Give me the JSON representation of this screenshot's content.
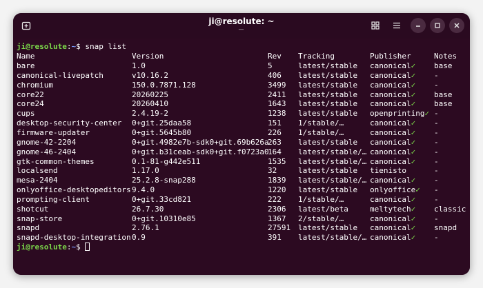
{
  "window": {
    "title": "ji@resolute: ~",
    "title_sub": "—"
  },
  "icons": {
    "new_tab": "new-tab-icon",
    "grid": "grid-icon",
    "menu": "hamburger-menu-icon",
    "minimize": "minimize-icon",
    "maximize": "maximize-icon",
    "close": "close-icon"
  },
  "terminal": {
    "prompt_user": "ji@resolute",
    "prompt_sep": ":",
    "prompt_path": "~",
    "prompt_end": "$ ",
    "command": "snap list",
    "headers": {
      "name": "Name",
      "version": "Version",
      "rev": "Rev",
      "tracking": "Tracking",
      "publisher": "Publisher",
      "notes": "Notes"
    },
    "rows": [
      {
        "name": "bare",
        "version": "1.0",
        "rev": "5",
        "tracking": "latest/stable",
        "publisher": "canonical",
        "verified": true,
        "notes": "base"
      },
      {
        "name": "canonical-livepatch",
        "version": "v10.16.2",
        "rev": "406",
        "tracking": "latest/stable",
        "publisher": "canonical",
        "verified": true,
        "notes": "-"
      },
      {
        "name": "chromium",
        "version": "150.0.7871.128",
        "rev": "3499",
        "tracking": "latest/stable",
        "publisher": "canonical",
        "verified": true,
        "notes": "-"
      },
      {
        "name": "core22",
        "version": "20260225",
        "rev": "2411",
        "tracking": "latest/stable",
        "publisher": "canonical",
        "verified": true,
        "notes": "base"
      },
      {
        "name": "core24",
        "version": "20260410",
        "rev": "1643",
        "tracking": "latest/stable",
        "publisher": "canonical",
        "verified": true,
        "notes": "base"
      },
      {
        "name": "cups",
        "version": "2.4.19-2",
        "rev": "1238",
        "tracking": "latest/stable",
        "publisher": "openprinting",
        "verified": true,
        "notes": "-"
      },
      {
        "name": "desktop-security-center",
        "version": "0+git.25daa58",
        "rev": "151",
        "tracking": "1/stable/…",
        "publisher": "canonical",
        "verified": true,
        "notes": "-"
      },
      {
        "name": "firmware-updater",
        "version": "0+git.5645b80",
        "rev": "226",
        "tracking": "1/stable/…",
        "publisher": "canonical",
        "verified": true,
        "notes": "-"
      },
      {
        "name": "gnome-42-2204",
        "version": "0+git.4982e7b-sdk0+git.69b626a",
        "rev": "263",
        "tracking": "latest/stable",
        "publisher": "canonical",
        "verified": true,
        "notes": "-"
      },
      {
        "name": "gnome-46-2404",
        "version": "0+git.b31ceab-sdk0+git.f0723a0",
        "rev": "164",
        "tracking": "latest/stable/…",
        "publisher": "canonical",
        "verified": true,
        "notes": "-"
      },
      {
        "name": "gtk-common-themes",
        "version": "0.1-81-g442e511",
        "rev": "1535",
        "tracking": "latest/stable/…",
        "publisher": "canonical",
        "verified": true,
        "notes": "-"
      },
      {
        "name": "localsend",
        "version": "1.17.0",
        "rev": "32",
        "tracking": "latest/stable",
        "publisher": "tienisto",
        "verified": false,
        "notes": "-"
      },
      {
        "name": "mesa-2404",
        "version": "25.2.8-snap288",
        "rev": "1839",
        "tracking": "latest/stable/…",
        "publisher": "canonical",
        "verified": true,
        "notes": "-"
      },
      {
        "name": "onlyoffice-desktopeditors",
        "version": "9.4.0",
        "rev": "1220",
        "tracking": "latest/stable",
        "publisher": "onlyoffice",
        "verified": true,
        "notes": "-"
      },
      {
        "name": "prompting-client",
        "version": "0+git.33cd821",
        "rev": "222",
        "tracking": "1/stable/…",
        "publisher": "canonical",
        "verified": true,
        "notes": "-"
      },
      {
        "name": "shotcut",
        "version": "26.7.30",
        "rev": "2306",
        "tracking": "latest/beta",
        "publisher": "meltytech",
        "verified": true,
        "notes": "classic"
      },
      {
        "name": "snap-store",
        "version": "0+git.10310e85",
        "rev": "1367",
        "tracking": "2/stable/…",
        "publisher": "canonical",
        "verified": true,
        "notes": "-"
      },
      {
        "name": "snapd",
        "version": "2.76.1",
        "rev": "27591",
        "tracking": "latest/stable",
        "publisher": "canonical",
        "verified": true,
        "notes": "snapd"
      },
      {
        "name": "snapd-desktop-integration",
        "version": "0.9",
        "rev": "391",
        "tracking": "latest/stable/…",
        "publisher": "canonical",
        "verified": true,
        "notes": "-"
      }
    ],
    "verified_mark": "✓"
  }
}
